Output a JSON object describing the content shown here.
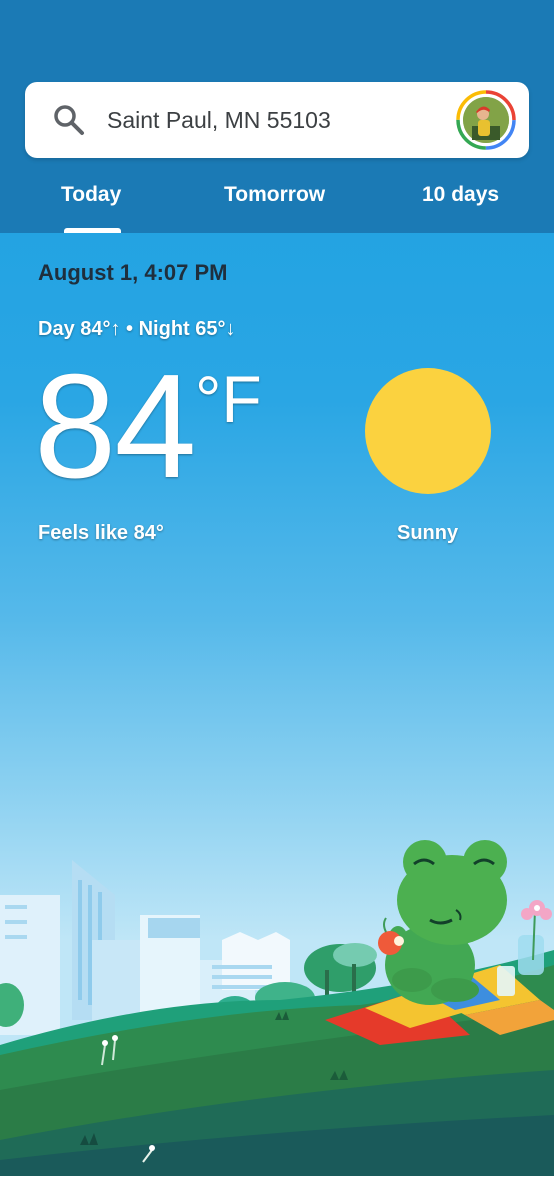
{
  "search": {
    "location": "Saint Paul, MN 55103",
    "icon": "search-icon",
    "avatar_icon": "avatar"
  },
  "tabs": [
    {
      "label": "Today",
      "selected": true
    },
    {
      "label": "Tomorrow",
      "selected": false
    },
    {
      "label": "10 days",
      "selected": false
    }
  ],
  "weather": {
    "datetime": "August 1, 4:07 PM",
    "day_night": "Day 84°↑ • Night 65°↓",
    "temperature": "84",
    "unit": "°F",
    "feels_like": "Feels like 84°",
    "condition": "Sunny",
    "condition_icon": "sun-icon"
  },
  "colors": {
    "header": "#1b7ab5",
    "sky_top": "#1a9fe0",
    "sun": "#fbd23f",
    "hill": "#2e8b4f",
    "frog": "#4cb050"
  }
}
